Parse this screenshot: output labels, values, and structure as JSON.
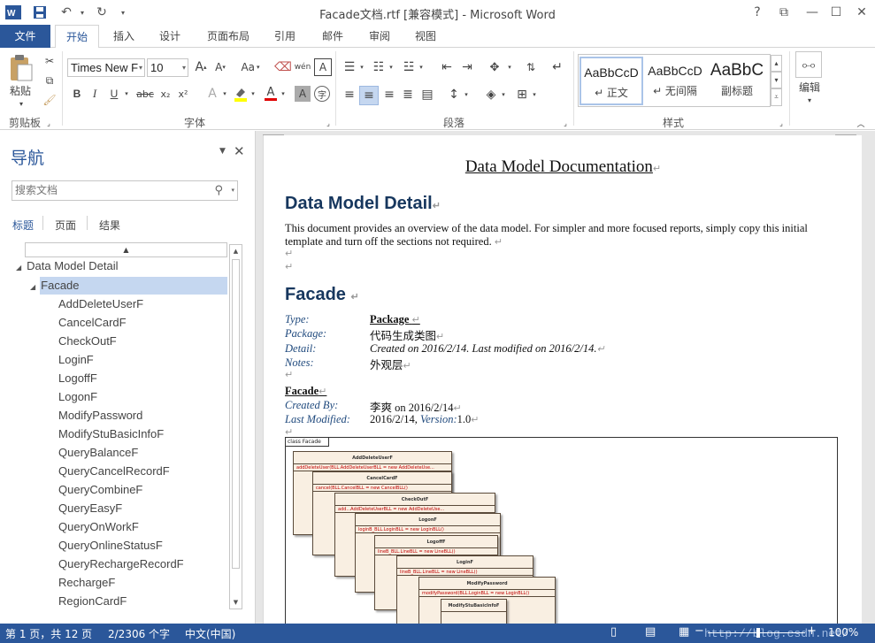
{
  "window": {
    "title": "Facade文档.rtf [兼容模式] - Microsoft Word",
    "help": "?",
    "brand_color": "#2b579a"
  },
  "tabs": [
    "文件",
    "开始",
    "插入",
    "设计",
    "页面布局",
    "引用",
    "邮件",
    "审阅",
    "视图"
  ],
  "ribbon": {
    "clipboard": {
      "paste": "粘贴",
      "label": "剪贴板"
    },
    "font": {
      "name": "Times New F",
      "size": "10",
      "grow": "A",
      "shrink": "A",
      "case": "Aa",
      "bold": "B",
      "italic": "I",
      "underline": "U",
      "strike": "abc",
      "sub": "x₂",
      "sup": "x²",
      "color_a": "A",
      "label": "字体"
    },
    "paragraph": {
      "label": "段落"
    },
    "styles": {
      "items": [
        {
          "sample": "AaBbCcD",
          "name": "↵ 正文"
        },
        {
          "sample": "AaBbCcD",
          "name": "↵ 无间隔"
        },
        {
          "sample": "AaBbC",
          "name": "副标题"
        }
      ],
      "label": "样式"
    },
    "editing": {
      "label": "编辑"
    }
  },
  "nav": {
    "title": "导航",
    "search_placeholder": "搜索文档",
    "tabs": [
      "标题",
      "页面",
      "结果"
    ],
    "tree": [
      "Data Model Detail",
      "Facade",
      "AddDeleteUserF",
      "CancelCardF",
      "CheckOutF",
      "LoginF",
      "LogoffF",
      "LogonF",
      "ModifyPassword",
      "ModifyStuBasicInfoF",
      "QueryBalanceF",
      "QueryCancelRecordF",
      "QueryCombineF",
      "QueryEasyF",
      "QueryOnWorkF",
      "QueryOnlineStatusF",
      "QueryRechargeRecordF",
      "RechargeF",
      "RegionCardF"
    ]
  },
  "doc": {
    "title": "Data Model Documentation",
    "h1": "Data Model Detail",
    "intro": "This document provides an overview of the data model. For simpler and more focused reports, simply copy this initial template and turn off the sections not required.",
    "h2": "Facade",
    "type_label": "Type:",
    "type_value": "Package",
    "package_label": "Package:",
    "package_value": "代码生成类图",
    "detail_label": "Detail:",
    "detail_value": "Created on 2016/2/14. Last modified on 2016/2/14.",
    "notes_label": "Notes:",
    "notes_value": "外观层",
    "subhead": "Facade",
    "created_label": "Created By:",
    "created_value": "李爽  on 2016/2/14",
    "modified_label": "Last Modified:",
    "modified_value": "2016/2/14,",
    "version_label": "Version:",
    "version_value": "1.0",
    "diagram": {
      "frame": "class Facade",
      "boxes": [
        {
          "name": "AddDeleteUserF",
          "attr": "addDeleteUser(BLL.AddDeleteUserBLL = new AddDeleteUse..."
        },
        {
          "name": "CancelCardF",
          "attr": "cancel(BLL.CancelBLL = new CancelBLL()"
        },
        {
          "name": "CheckOutF",
          "attr": "add...AddDeleteUserBLL = new AddDeleteUse..."
        },
        {
          "name": "LogonF",
          "attr": "loginB_BLL.LoginBLL = new LoginBLL()"
        },
        {
          "name": "LogoffF",
          "attr": "lineB_BLL.LineBLL = new LineBLL()"
        },
        {
          "name": "LoginF",
          "attr": "lineB_BLL.LineBLL = new LineBLL()"
        },
        {
          "name": "ModifyPassword",
          "attr": "modifyPassword(BLL.LoginBLL = new LoginBLL()"
        },
        {
          "name": "ModifyStuBasicInfoF",
          "attr": ""
        }
      ]
    }
  },
  "status": {
    "page": "第 1 页，共 12 页",
    "words": "2/2306 个字",
    "lang": "中文(中国)",
    "zoom": "100%",
    "watermark": "http://blog.csdn.net/"
  }
}
